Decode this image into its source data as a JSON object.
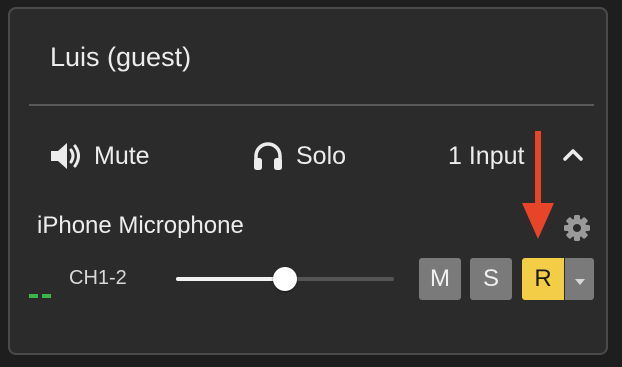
{
  "participant": {
    "name": "Luis (guest)"
  },
  "controls": {
    "mute_label": "Mute",
    "solo_label": "Solo",
    "inputs_label": "1 Input",
    "mute_icon": "speaker-icon",
    "solo_icon": "headphones-icon",
    "collapse_icon": "chevron-up-icon"
  },
  "input": {
    "device_name": "iPhone Microphone",
    "channel": "CH1-2",
    "volume_fraction": 0.5,
    "buttons": {
      "mute": "M",
      "solo": "S",
      "record": "R"
    },
    "record_active": true
  },
  "colors": {
    "record_active": "#f2cd45",
    "meter": "#3ab54a",
    "annotation_arrow": "#e8442a",
    "button_gray": "#7a7a7a"
  }
}
